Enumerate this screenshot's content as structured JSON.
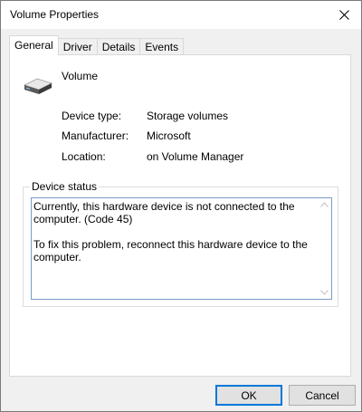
{
  "window": {
    "title": "Volume Properties"
  },
  "tabs": [
    {
      "label": "General",
      "active": true
    },
    {
      "label": "Driver",
      "active": false
    },
    {
      "label": "Details",
      "active": false
    },
    {
      "label": "Events",
      "active": false
    }
  ],
  "device": {
    "name": "Volume",
    "icon": "drive-icon",
    "properties": [
      {
        "label": "Device type:",
        "value": "Storage volumes"
      },
      {
        "label": "Manufacturer:",
        "value": "Microsoft"
      },
      {
        "label": "Location:",
        "value": "on Volume Manager"
      }
    ]
  },
  "status": {
    "legend": "Device status",
    "line1": "Currently, this hardware device is not connected to the computer. (Code 45)",
    "line2": "To fix this problem, reconnect this hardware device to the computer."
  },
  "buttons": {
    "ok": "OK",
    "cancel": "Cancel"
  },
  "colors": {
    "accent": "#0078d7",
    "window_bg": "#f0f0f0",
    "panel_bg": "#ffffff"
  }
}
